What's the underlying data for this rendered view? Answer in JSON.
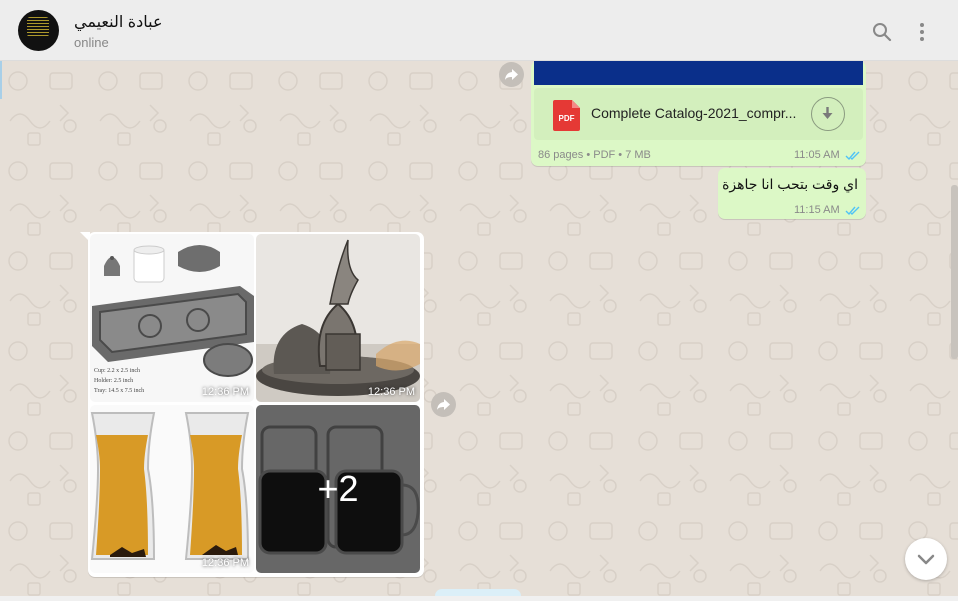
{
  "header": {
    "contact_name": "عبادة النعيمي",
    "status": "online",
    "icons": [
      "search-icon",
      "menu-icon"
    ]
  },
  "messages": {
    "document": {
      "file_name": "Complete Catalog-2021_compr...",
      "file_type_badge": "PDF",
      "meta": "86 pages • PDF • 7 MB",
      "time": "11:05 AM",
      "read": true
    },
    "text": {
      "body": "اي وقت بتحب انا جاهزة",
      "time": "11:15 AM",
      "read": true
    },
    "album": {
      "tiles": [
        {
          "subject": "silver tray with cups",
          "time": "12:36 PM"
        },
        {
          "subject": "silver coffee cup set",
          "time": "12:36 PM"
        },
        {
          "subject": "glass tea cups",
          "time": "12:36 PM"
        },
        {
          "subject": "double wall espresso cups",
          "more_label": "+2"
        }
      ]
    }
  },
  "colors": {
    "outgoing_bubble": "#dcf8c6",
    "chat_background": "#e6dfd7",
    "read_ticks": "#4fc3f7",
    "pdf_red": "#e53935"
  }
}
